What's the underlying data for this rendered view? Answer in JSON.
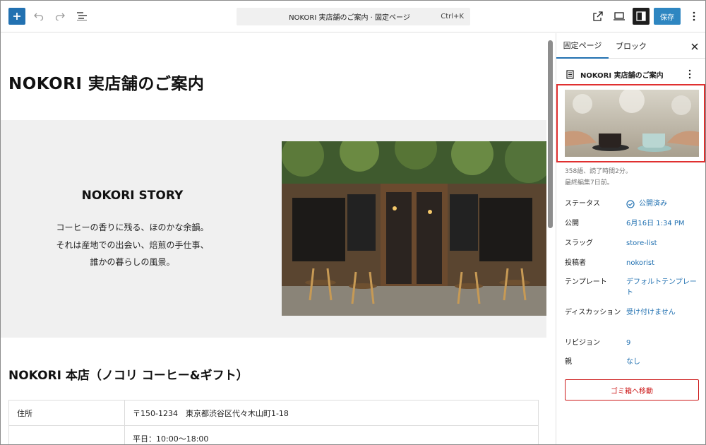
{
  "toolbar": {
    "command_title": "NOKORI 実店舗のご案内 · 固定ページ",
    "command_shortcut": "Ctrl+K",
    "save_label": "保存"
  },
  "canvas": {
    "page_title": "NOKORI 実店舗のご案内",
    "story_heading": "NOKORI STORY",
    "story_lines": [
      "コーヒーの香りに残る、ほのかな余韻。",
      "それは産地での出会い、焙煎の手仕事、",
      "誰かの暮らしの風景。"
    ],
    "section_heading": "NOKORI 本店（ノコリ コーヒー&ギフト）",
    "table": [
      {
        "key": "住所",
        "value": "〒150-1234　東京都渋谷区代々木山町1-18"
      },
      {
        "key": "",
        "value": "平日：10:00〜18:00"
      }
    ]
  },
  "sidebar": {
    "tab_page": "固定ページ",
    "tab_block": "ブロック",
    "doc_title": "NOKORI 実店舗のご案内",
    "meta_line1": "358語、読了時間2分。",
    "meta_line2": "最終編集7日前。",
    "rows": [
      {
        "label": "ステータス",
        "value": "公開済み"
      },
      {
        "label": "公開",
        "value": "6月16日 1:34 PM"
      },
      {
        "label": "スラッグ",
        "value": "store-list"
      },
      {
        "label": "投稿者",
        "value": "nokorist"
      },
      {
        "label": "テンプレート",
        "value": "デフォルトテンプレート"
      },
      {
        "label": "ディスカッション",
        "value": "受け付けません"
      },
      {
        "label": "リビジョン",
        "value": "9"
      },
      {
        "label": "親",
        "value": "なし"
      }
    ],
    "trash_label": "ゴミ箱へ移動"
  },
  "colors": {
    "accent": "#2271b1",
    "save_bg": "#2e86c1",
    "danger": "#cc1818",
    "highlight_border": "#e03030"
  }
}
